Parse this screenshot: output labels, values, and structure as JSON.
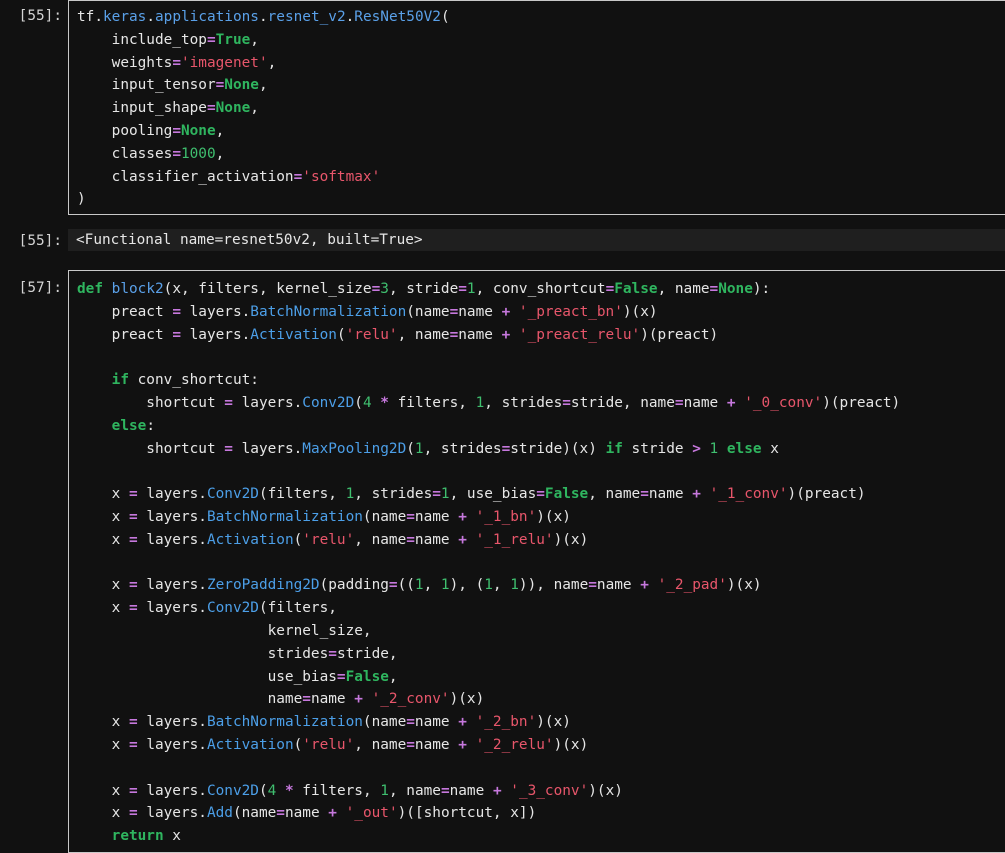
{
  "cells": [
    {
      "prompt": "[55]:",
      "type": "input",
      "lines": [
        [
          [
            "t",
            "tf."
          ],
          [
            "mod",
            "keras"
          ],
          [
            "t",
            "."
          ],
          [
            "mod",
            "applications"
          ],
          [
            "t",
            "."
          ],
          [
            "mod",
            "resnet_v2"
          ],
          [
            "t",
            "."
          ],
          [
            "mod",
            "ResNet50V2"
          ],
          [
            "t",
            "("
          ]
        ],
        [
          [
            "t",
            "    include_top"
          ],
          [
            "op",
            "="
          ],
          [
            "kw",
            "True"
          ],
          [
            "t",
            ","
          ]
        ],
        [
          [
            "t",
            "    weights"
          ],
          [
            "op",
            "="
          ],
          [
            "str",
            "'imagenet'"
          ],
          [
            "t",
            ","
          ]
        ],
        [
          [
            "t",
            "    input_tensor"
          ],
          [
            "op",
            "="
          ],
          [
            "kw",
            "None"
          ],
          [
            "t",
            ","
          ]
        ],
        [
          [
            "t",
            "    input_shape"
          ],
          [
            "op",
            "="
          ],
          [
            "kw",
            "None"
          ],
          [
            "t",
            ","
          ]
        ],
        [
          [
            "t",
            "    pooling"
          ],
          [
            "op",
            "="
          ],
          [
            "kw",
            "None"
          ],
          [
            "t",
            ","
          ]
        ],
        [
          [
            "t",
            "    classes"
          ],
          [
            "op",
            "="
          ],
          [
            "num",
            "1000"
          ],
          [
            "t",
            ","
          ]
        ],
        [
          [
            "t",
            "    classifier_activation"
          ],
          [
            "op",
            "="
          ],
          [
            "str",
            "'softmax'"
          ]
        ],
        [
          [
            "t",
            ")"
          ]
        ]
      ]
    },
    {
      "prompt": "[55]:",
      "type": "output",
      "text": "<Functional name=resnet50v2, built=True>"
    },
    {
      "prompt": "[57]:",
      "type": "input",
      "lines": [
        [
          [
            "kw",
            "def"
          ],
          [
            "t",
            " "
          ],
          [
            "fn",
            "block2"
          ],
          [
            "t",
            "(x, filters, kernel_size"
          ],
          [
            "op",
            "="
          ],
          [
            "num",
            "3"
          ],
          [
            "t",
            ", stride"
          ],
          [
            "op",
            "="
          ],
          [
            "num",
            "1"
          ],
          [
            "t",
            ", conv_shortcut"
          ],
          [
            "op",
            "="
          ],
          [
            "kw",
            "False"
          ],
          [
            "t",
            ", name"
          ],
          [
            "op",
            "="
          ],
          [
            "kw",
            "None"
          ],
          [
            "t",
            "):"
          ]
        ],
        [
          [
            "t",
            "    preact "
          ],
          [
            "op",
            "="
          ],
          [
            "t",
            " layers."
          ],
          [
            "cls",
            "BatchNormalization"
          ],
          [
            "t",
            "(name"
          ],
          [
            "op",
            "="
          ],
          [
            "t",
            "name "
          ],
          [
            "op",
            "+"
          ],
          [
            "t",
            " "
          ],
          [
            "str",
            "'_preact_bn'"
          ],
          [
            "t",
            ")(x)"
          ]
        ],
        [
          [
            "t",
            "    preact "
          ],
          [
            "op",
            "="
          ],
          [
            "t",
            " layers."
          ],
          [
            "cls",
            "Activation"
          ],
          [
            "t",
            "("
          ],
          [
            "str",
            "'relu'"
          ],
          [
            "t",
            ", name"
          ],
          [
            "op",
            "="
          ],
          [
            "t",
            "name "
          ],
          [
            "op",
            "+"
          ],
          [
            "t",
            " "
          ],
          [
            "str",
            "'_preact_relu'"
          ],
          [
            "t",
            ")(preact)"
          ]
        ],
        [
          [
            "t",
            ""
          ]
        ],
        [
          [
            "t",
            "    "
          ],
          [
            "kw",
            "if"
          ],
          [
            "t",
            " conv_shortcut:"
          ]
        ],
        [
          [
            "t",
            "        shortcut "
          ],
          [
            "op",
            "="
          ],
          [
            "t",
            " layers."
          ],
          [
            "cls",
            "Conv2D"
          ],
          [
            "t",
            "("
          ],
          [
            "num",
            "4"
          ],
          [
            "t",
            " "
          ],
          [
            "op",
            "*"
          ],
          [
            "t",
            " filters, "
          ],
          [
            "num",
            "1"
          ],
          [
            "t",
            ", strides"
          ],
          [
            "op",
            "="
          ],
          [
            "t",
            "stride, name"
          ],
          [
            "op",
            "="
          ],
          [
            "t",
            "name "
          ],
          [
            "op",
            "+"
          ],
          [
            "t",
            " "
          ],
          [
            "str",
            "'_0_conv'"
          ],
          [
            "t",
            ")(preact)"
          ]
        ],
        [
          [
            "t",
            "    "
          ],
          [
            "kw",
            "else"
          ],
          [
            "t",
            ":"
          ]
        ],
        [
          [
            "t",
            "        shortcut "
          ],
          [
            "op",
            "="
          ],
          [
            "t",
            " layers."
          ],
          [
            "cls",
            "MaxPooling2D"
          ],
          [
            "t",
            "("
          ],
          [
            "num",
            "1"
          ],
          [
            "t",
            ", strides"
          ],
          [
            "op",
            "="
          ],
          [
            "t",
            "stride)(x) "
          ],
          [
            "kw",
            "if"
          ],
          [
            "t",
            " stride "
          ],
          [
            "op",
            ">"
          ],
          [
            "t",
            " "
          ],
          [
            "num",
            "1"
          ],
          [
            "t",
            " "
          ],
          [
            "kw",
            "else"
          ],
          [
            "t",
            " x"
          ]
        ],
        [
          [
            "t",
            ""
          ]
        ],
        [
          [
            "t",
            "    x "
          ],
          [
            "op",
            "="
          ],
          [
            "t",
            " layers."
          ],
          [
            "cls",
            "Conv2D"
          ],
          [
            "t",
            "(filters, "
          ],
          [
            "num",
            "1"
          ],
          [
            "t",
            ", strides"
          ],
          [
            "op",
            "="
          ],
          [
            "num",
            "1"
          ],
          [
            "t",
            ", use_bias"
          ],
          [
            "op",
            "="
          ],
          [
            "kw",
            "False"
          ],
          [
            "t",
            ", name"
          ],
          [
            "op",
            "="
          ],
          [
            "t",
            "name "
          ],
          [
            "op",
            "+"
          ],
          [
            "t",
            " "
          ],
          [
            "str",
            "'_1_conv'"
          ],
          [
            "t",
            ")(preact)"
          ]
        ],
        [
          [
            "t",
            "    x "
          ],
          [
            "op",
            "="
          ],
          [
            "t",
            " layers."
          ],
          [
            "cls",
            "BatchNormalization"
          ],
          [
            "t",
            "(name"
          ],
          [
            "op",
            "="
          ],
          [
            "t",
            "name "
          ],
          [
            "op",
            "+"
          ],
          [
            "t",
            " "
          ],
          [
            "str",
            "'_1_bn'"
          ],
          [
            "t",
            ")(x)"
          ]
        ],
        [
          [
            "t",
            "    x "
          ],
          [
            "op",
            "="
          ],
          [
            "t",
            " layers."
          ],
          [
            "cls",
            "Activation"
          ],
          [
            "t",
            "("
          ],
          [
            "str",
            "'relu'"
          ],
          [
            "t",
            ", name"
          ],
          [
            "op",
            "="
          ],
          [
            "t",
            "name "
          ],
          [
            "op",
            "+"
          ],
          [
            "t",
            " "
          ],
          [
            "str",
            "'_1_relu'"
          ],
          [
            "t",
            ")(x)"
          ]
        ],
        [
          [
            "t",
            ""
          ]
        ],
        [
          [
            "t",
            "    x "
          ],
          [
            "op",
            "="
          ],
          [
            "t",
            " layers."
          ],
          [
            "cls",
            "ZeroPadding2D"
          ],
          [
            "t",
            "(padding"
          ],
          [
            "op",
            "="
          ],
          [
            "t",
            "(("
          ],
          [
            "num",
            "1"
          ],
          [
            "t",
            ", "
          ],
          [
            "num",
            "1"
          ],
          [
            "t",
            "), ("
          ],
          [
            "num",
            "1"
          ],
          [
            "t",
            ", "
          ],
          [
            "num",
            "1"
          ],
          [
            "t",
            ")), name"
          ],
          [
            "op",
            "="
          ],
          [
            "t",
            "name "
          ],
          [
            "op",
            "+"
          ],
          [
            "t",
            " "
          ],
          [
            "str",
            "'_2_pad'"
          ],
          [
            "t",
            ")(x)"
          ]
        ],
        [
          [
            "t",
            "    x "
          ],
          [
            "op",
            "="
          ],
          [
            "t",
            " layers."
          ],
          [
            "cls",
            "Conv2D"
          ],
          [
            "t",
            "(filters,"
          ]
        ],
        [
          [
            "t",
            "                      kernel_size,"
          ]
        ],
        [
          [
            "t",
            "                      strides"
          ],
          [
            "op",
            "="
          ],
          [
            "t",
            "stride,"
          ]
        ],
        [
          [
            "t",
            "                      use_bias"
          ],
          [
            "op",
            "="
          ],
          [
            "kw",
            "False"
          ],
          [
            "t",
            ","
          ]
        ],
        [
          [
            "t",
            "                      name"
          ],
          [
            "op",
            "="
          ],
          [
            "t",
            "name "
          ],
          [
            "op",
            "+"
          ],
          [
            "t",
            " "
          ],
          [
            "str",
            "'_2_conv'"
          ],
          [
            "t",
            ")(x)"
          ]
        ],
        [
          [
            "t",
            "    x "
          ],
          [
            "op",
            "="
          ],
          [
            "t",
            " layers."
          ],
          [
            "cls",
            "BatchNormalization"
          ],
          [
            "t",
            "(name"
          ],
          [
            "op",
            "="
          ],
          [
            "t",
            "name "
          ],
          [
            "op",
            "+"
          ],
          [
            "t",
            " "
          ],
          [
            "str",
            "'_2_bn'"
          ],
          [
            "t",
            ")(x)"
          ]
        ],
        [
          [
            "t",
            "    x "
          ],
          [
            "op",
            "="
          ],
          [
            "t",
            " layers."
          ],
          [
            "cls",
            "Activation"
          ],
          [
            "t",
            "("
          ],
          [
            "str",
            "'relu'"
          ],
          [
            "t",
            ", name"
          ],
          [
            "op",
            "="
          ],
          [
            "t",
            "name "
          ],
          [
            "op",
            "+"
          ],
          [
            "t",
            " "
          ],
          [
            "str",
            "'_2_relu'"
          ],
          [
            "t",
            ")(x)"
          ]
        ],
        [
          [
            "t",
            ""
          ]
        ],
        [
          [
            "t",
            "    x "
          ],
          [
            "op",
            "="
          ],
          [
            "t",
            " layers."
          ],
          [
            "cls",
            "Conv2D"
          ],
          [
            "t",
            "("
          ],
          [
            "num",
            "4"
          ],
          [
            "t",
            " "
          ],
          [
            "op",
            "*"
          ],
          [
            "t",
            " filters, "
          ],
          [
            "num",
            "1"
          ],
          [
            "t",
            ", name"
          ],
          [
            "op",
            "="
          ],
          [
            "t",
            "name "
          ],
          [
            "op",
            "+"
          ],
          [
            "t",
            " "
          ],
          [
            "str",
            "'_3_conv'"
          ],
          [
            "t",
            ")(x)"
          ]
        ],
        [
          [
            "t",
            "    x "
          ],
          [
            "op",
            "="
          ],
          [
            "t",
            " layers."
          ],
          [
            "cls",
            "Add"
          ],
          [
            "t",
            "(name"
          ],
          [
            "op",
            "="
          ],
          [
            "t",
            "name "
          ],
          [
            "op",
            "+"
          ],
          [
            "t",
            " "
          ],
          [
            "str",
            "'_out'"
          ],
          [
            "t",
            ")([shortcut, x])"
          ]
        ],
        [
          [
            "t",
            "    "
          ],
          [
            "kw",
            "return"
          ],
          [
            "t",
            " x"
          ]
        ]
      ]
    }
  ]
}
